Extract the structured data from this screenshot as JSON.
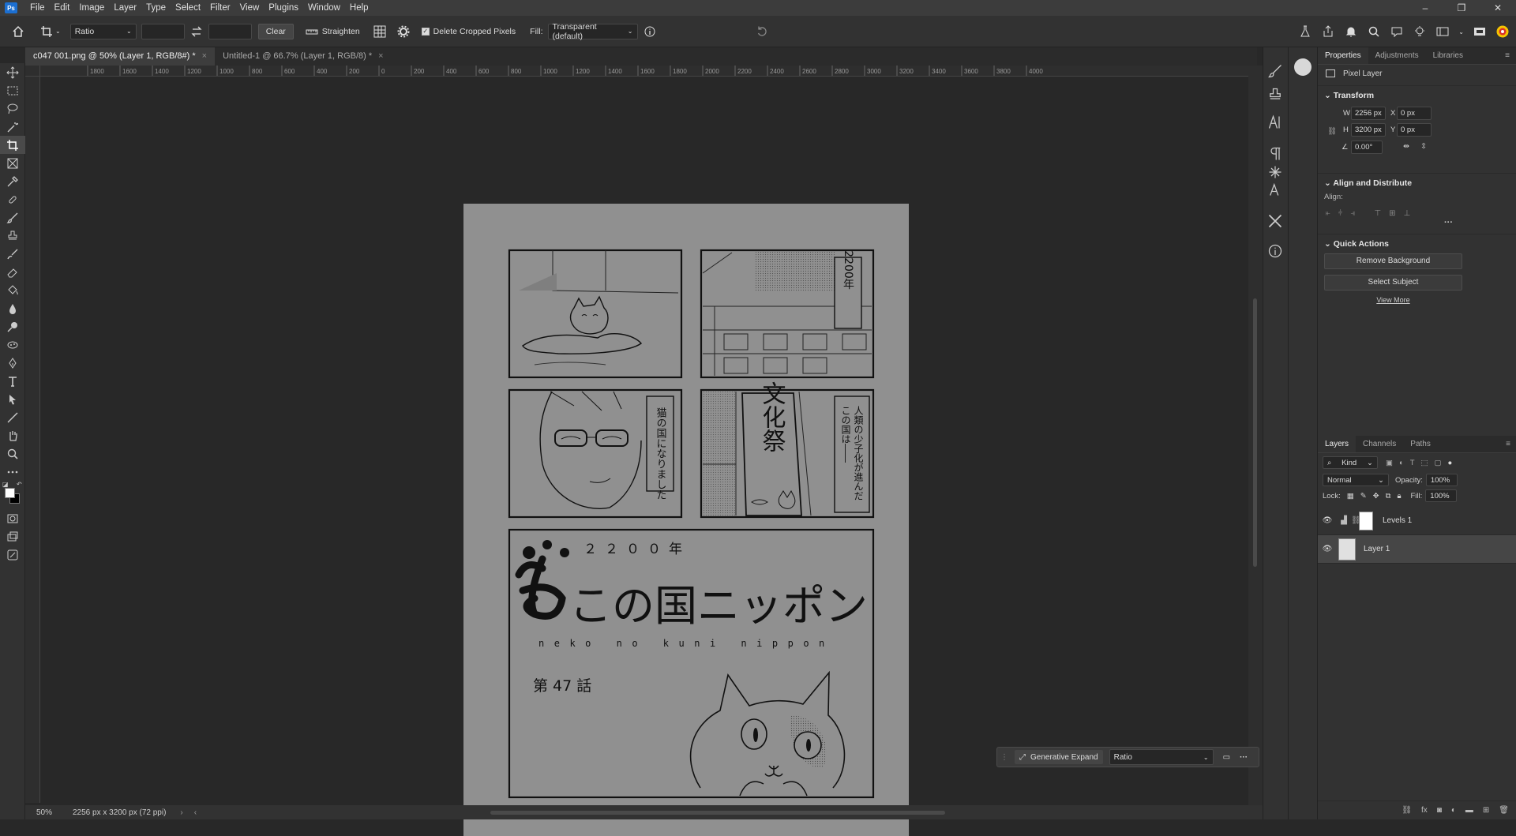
{
  "menu": {
    "items": [
      "File",
      "Edit",
      "Image",
      "Layer",
      "Type",
      "Select",
      "Filter",
      "View",
      "Plugins",
      "Window",
      "Help"
    ]
  },
  "options": {
    "ratio": "Ratio",
    "width_value": "",
    "height_value": "",
    "clear": "Clear",
    "straighten": "Straighten",
    "delete_cropped": "Delete Cropped Pixels",
    "fill_label": "Fill:",
    "fill_value": "Transparent (default)"
  },
  "tabs": [
    {
      "label": "c047 001.png @ 50% (Layer 1, RGB/8#) *",
      "close": "×"
    },
    {
      "label": "Untitled-1 @ 66.7% (Layer 1, RGB/8) *",
      "close": "×"
    }
  ],
  "ruler": {
    "top_ticks": [
      "1800",
      "1600",
      "1400",
      "1200",
      "1000",
      "800",
      "600",
      "400",
      "200",
      "0",
      "200",
      "400",
      "600",
      "800",
      "1000",
      "1200",
      "1400",
      "1600",
      "1800",
      "2000",
      "2200",
      "2400",
      "2600",
      "2800",
      "3000",
      "3200",
      "3400",
      "3600",
      "3800",
      "4000"
    ]
  },
  "artwork": {
    "year_vertical": "2200年",
    "cat_country_vertical": "猫の国になりました",
    "festival_sign": "文化祭",
    "depopulation_vertical1": "人類の少子化が進んだ",
    "depopulation_vertical2": "この国は――",
    "title_year": "２２００年",
    "title_main": "この国ニッポン",
    "title_romaji": "neko no kuni nippon",
    "chapter": "第 47 話"
  },
  "properties": {
    "tabs": [
      "Properties",
      "Adjustments",
      "Libraries"
    ],
    "layer_kind": "Pixel Layer",
    "transform_title": "Transform",
    "w_label": "W",
    "w_value": "2256 px",
    "h_label": "H",
    "h_value": "3200 px",
    "x_label": "X",
    "x_value": "0 px",
    "y_label": "Y",
    "y_value": "0 px",
    "angle_value": "0.00°",
    "align_title": "Align and Distribute",
    "align_label": "Align:",
    "quick_title": "Quick Actions",
    "remove_bg": "Remove Background",
    "select_subject": "Select Subject",
    "view_more": "View More"
  },
  "layers": {
    "tabs": [
      "Layers",
      "Channels",
      "Paths"
    ],
    "kind": "Kind",
    "blend_mode": "Normal",
    "opacity_label": "Opacity:",
    "opacity_value": "100%",
    "lock_label": "Lock:",
    "fill_label": "Fill:",
    "fill_value": "100%",
    "items": [
      {
        "name": "Levels 1"
      },
      {
        "name": "Layer 1"
      }
    ]
  },
  "status": {
    "zoom": "50%",
    "doc_size": "2256 px x 3200 px (72 ppi)"
  },
  "generative": {
    "label": "Generative Expand",
    "ratio": "Ratio"
  }
}
